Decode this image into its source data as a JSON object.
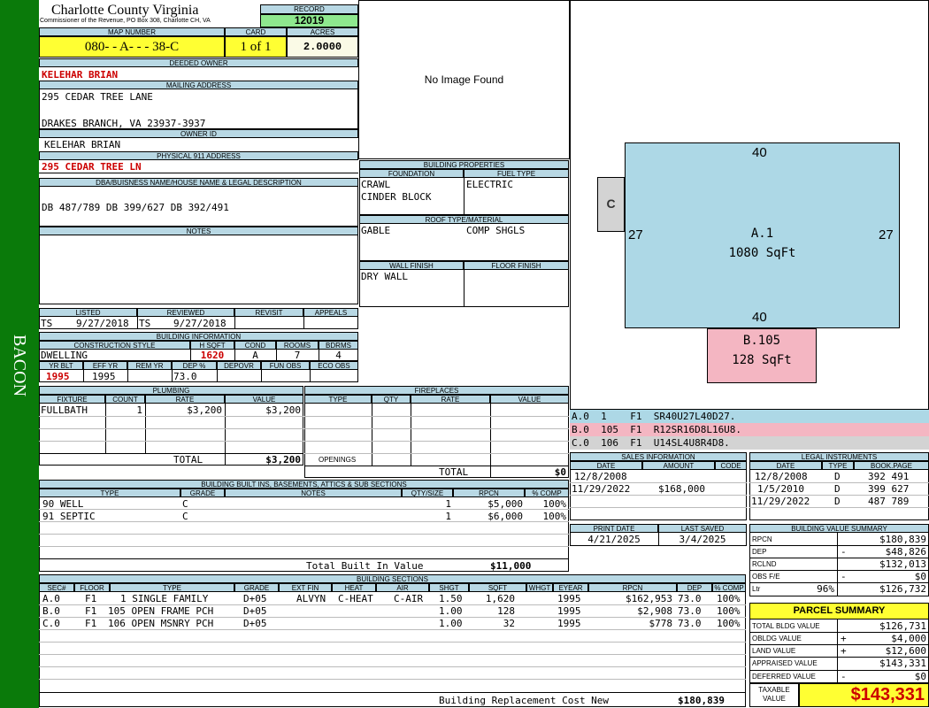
{
  "sidebar": {
    "label": "BACON",
    "color": "#0a7a0a"
  },
  "header": {
    "county": "Charlotte County Virginia",
    "office": "Commissioner of the Revenue, PO Box 308, Charlotte CH, VA",
    "record_label": "RECORD",
    "record": "12019",
    "map_number_label": "MAP NUMBER",
    "map_number": "080- - A- - - 38-C",
    "card_label": "CARD",
    "card": "1 of 1",
    "acres_label": "ACRES",
    "acres": "2.0000"
  },
  "owner": {
    "deeded_label": "DEEDED OWNER",
    "deeded": "KELEHAR BRIAN",
    "mailing_label": "MAILING ADDRESS",
    "mailing1": "295 CEDAR TREE LANE",
    "mailing2": "DRAKES BRANCH, VA 23937-3937",
    "id_label": "OWNER ID",
    "id": "KELEHAR BRIAN",
    "physical_label": "PHYSICAL 911 ADDRESS",
    "physical": "295 CEDAR TREE LN",
    "legal_label": "DBA/BUISNESS NAME/HOUSE NAME & LEGAL DESCRIPTION",
    "legal": "DB 487/789 DB 399/627 DB 392/491",
    "notes_label": "NOTES"
  },
  "image": {
    "placeholder": "No Image Found"
  },
  "building_properties": {
    "title": "BUILDING PROPERTIES",
    "foundation_label": "FOUNDATION",
    "foundation1": "CRAWL",
    "foundation2": "CINDER BLOCK",
    "fuel_label": "FUEL TYPE",
    "fuel": "ELECTRIC",
    "roof_label": "ROOF TYPE/MATERIAL",
    "roof_type": "GABLE",
    "roof_material": "COMP SHGLS",
    "wall_label": "WALL FINISH",
    "wall": "DRY WALL",
    "floor_label": "FLOOR FINISH",
    "floor": ""
  },
  "review": {
    "listed_label": "LISTED",
    "listed_by": "TS",
    "listed_date": "9/27/2018",
    "reviewed_label": "REVIEWED",
    "reviewed_by": "TS",
    "reviewed_date": "9/27/2018",
    "revisit_label": "REVISIT",
    "appeals_label": "APPEALS"
  },
  "building_info": {
    "title": "BUILDING INFORMATION",
    "style_label": "CONSTRUCTION STYLE",
    "style": "DWELLING",
    "hsqft_label": "H SQFT",
    "hsqft": "1620",
    "cond_label": "COND",
    "cond": "A",
    "rooms_label": "ROOMS",
    "rooms": "7",
    "bdrms_label": "BDRMS",
    "bdrms": "4",
    "yrblt_label": "YR BLT",
    "yrblt": "1995",
    "effyr_label": "EFF YR",
    "effyr": "1995",
    "remyr_label": "REM YR",
    "remyr": "",
    "dep_label": "DEP %",
    "dep": "73.0",
    "depovr_label": "DEPOVR",
    "depovr": "",
    "funobs_label": "FUN OBS",
    "funobs": "",
    "ecoobs_label": "ECO OBS",
    "ecoobs": ""
  },
  "plumbing": {
    "title": "PLUMBING",
    "headers": [
      "FIXTURE",
      "COUNT",
      "RATE",
      "VALUE"
    ],
    "rows": [
      {
        "fixture": "FULLBATH",
        "count": "1",
        "rate": "$3,200",
        "value": "$3,200"
      }
    ],
    "total_label": "TOTAL",
    "total": "$3,200"
  },
  "fireplaces": {
    "title": "FIREPLACES",
    "headers": [
      "TYPE",
      "QTY",
      "RATE",
      "VALUE"
    ],
    "openings_label": "OPENINGS",
    "total_label": "TOTAL",
    "total": "$0"
  },
  "sketch": {
    "a_label": "A.1",
    "a_area": "1080 SqFt",
    "a_top": "40",
    "a_bottom": "40",
    "a_left": "27",
    "a_right": "27",
    "b_label": "B.105",
    "b_area": "128 SqFt",
    "c_label": "C",
    "colors": {
      "a": "#add8e6",
      "b": "#f4b6c2",
      "c": "#d3d3d3"
    }
  },
  "sketch_legend": [
    {
      "text": "A.0  1    F1  SR40U27L40D27.",
      "color": "#add8e6"
    },
    {
      "text": "B.0  105  F1  R12SR16D8L16U8.",
      "color": "#f4b6c2"
    },
    {
      "text": "C.0  106  F1  U14SL4U8R4D8.",
      "color": "#d3d3d3"
    }
  ],
  "sales": {
    "title": "SALES INFORMATION",
    "headers": [
      "DATE",
      "AMOUNT",
      "CODE"
    ],
    "rows": [
      {
        "date": "12/8/2008",
        "amount": "",
        "code": ""
      },
      {
        "date": "11/29/2022",
        "amount": "$168,000",
        "code": ""
      }
    ]
  },
  "legal_instruments": {
    "title": "LEGAL INSTRUMENTS",
    "headers": [
      "DATE",
      "TYPE",
      "BOOK.PAGE"
    ],
    "rows": [
      {
        "date": "12/8/2008",
        "type": "D",
        "book": "392 491"
      },
      {
        "date": "1/5/2010",
        "type": "D",
        "book": "399 627"
      },
      {
        "date": "11/29/2022",
        "type": "D",
        "book": "487 789"
      }
    ]
  },
  "print": {
    "print_label": "PRINT DATE",
    "print_date": "4/21/2025",
    "saved_label": "LAST SAVED",
    "saved_date": "3/4/2025"
  },
  "built_ins": {
    "title": "BUILDING BUILT INS, BASEMENTS, ATTICS & SUB SECTIONS",
    "headers": [
      "TYPE",
      "GRADE",
      "NOTES",
      "QTY/SIZE",
      "RPCN",
      "% COMP"
    ],
    "rows": [
      {
        "type": "90 WELL",
        "grade": "C",
        "notes": "",
        "qty": "1",
        "rpcn": "$5,000",
        "comp": "100%"
      },
      {
        "type": "91 SEPTIC",
        "grade": "C",
        "notes": "",
        "qty": "1",
        "rpcn": "$6,000",
        "comp": "100%"
      }
    ],
    "total_label": "Total Built In Value",
    "total": "$11,000"
  },
  "value_summary": {
    "title": "BUILDING VALUE SUMMARY",
    "rows": [
      {
        "label": "RPCN",
        "sign": "",
        "pct": "",
        "value": "$180,839"
      },
      {
        "label": "DEP",
        "sign": "-",
        "pct": "",
        "value": "$48,826"
      },
      {
        "label": "RCLND",
        "sign": "",
        "pct": "",
        "value": "$132,013"
      },
      {
        "label": "OBS F/E",
        "sign": "-",
        "pct": "",
        "value": "$0"
      },
      {
        "label": "Ltr",
        "sign": "",
        "pct": "96%",
        "value": "$126,732"
      }
    ]
  },
  "building_sections": {
    "title": "BUILDING SECTIONS",
    "headers": [
      "SEC#",
      "FLOOR",
      "TYPE",
      "GRADE",
      "EXT FIN",
      "HEAT",
      "AIR",
      "SHGT",
      "SQFT",
      "WHGT",
      "EYEAR",
      "RPCN",
      "DEP",
      "% COMP"
    ],
    "rows": [
      {
        "sec": "A.0",
        "floor": "F1",
        "type": "1 SINGLE FAMILY",
        "grade": "D+05",
        "ext": "ALVYN",
        "heat": "C-HEAT",
        "air": "C-AIR",
        "shgt": "1.50",
        "sqft": "1,620",
        "whgt": "",
        "eyear": "1995",
        "rpcn": "$162,953",
        "dep": "73.0",
        "comp": "100%"
      },
      {
        "sec": "B.0",
        "floor": "F1",
        "type": "105 OPEN FRAME PCH",
        "grade": "D+05",
        "ext": "",
        "heat": "",
        "air": "",
        "shgt": "1.00",
        "sqft": "128",
        "whgt": "",
        "eyear": "1995",
        "rpcn": "$2,908",
        "dep": "73.0",
        "comp": "100%"
      },
      {
        "sec": "C.0",
        "floor": "F1",
        "type": "106 OPEN MSNRY PCH",
        "grade": "D+05",
        "ext": "",
        "heat": "",
        "air": "",
        "shgt": "1.00",
        "sqft": "32",
        "whgt": "",
        "eyear": "1995",
        "rpcn": "$778",
        "dep": "73.0",
        "comp": "100%"
      }
    ],
    "total_label": "Building Replacement Cost New",
    "total": "$180,839"
  },
  "parcel_summary": {
    "title": "PARCEL SUMMARY",
    "rows": [
      {
        "label": "TOTAL BLDG VALUE",
        "sign": "",
        "value": "$126,731"
      },
      {
        "label": "OBLDG VALUE",
        "sign": "+",
        "value": "$4,000"
      },
      {
        "label": "LAND VALUE",
        "sign": "+",
        "value": "$12,600"
      },
      {
        "label": "APPRAISED VALUE",
        "sign": "",
        "value": "$143,331"
      },
      {
        "label": "DEFERRED VALUE",
        "sign": "-",
        "value": "$0"
      }
    ],
    "taxable_label1": "TAXABLE",
    "taxable_label2": "VALUE",
    "taxable": "$143,331"
  }
}
